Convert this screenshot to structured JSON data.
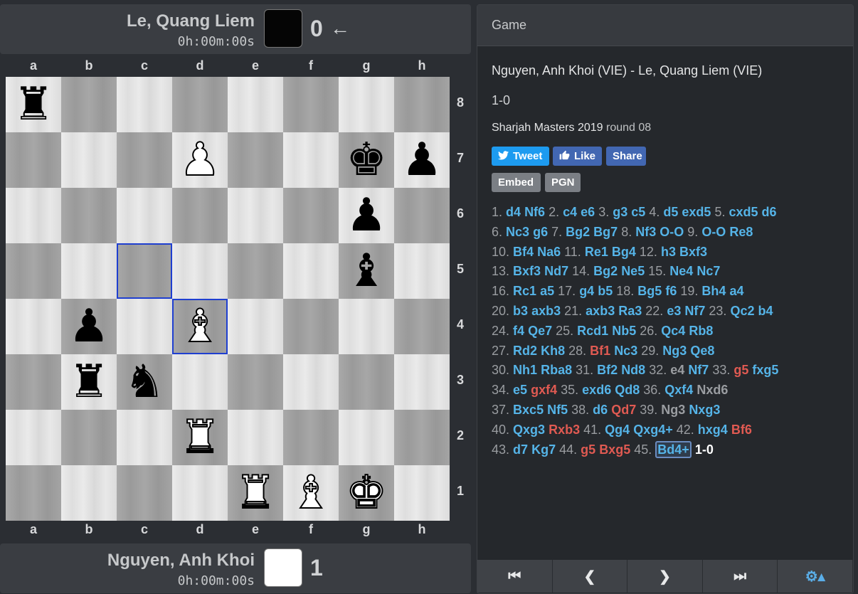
{
  "top_player": {
    "name": "Le, Quang Liem",
    "clock": "0h:00m:00s",
    "score": "0",
    "arrow": "←"
  },
  "bottom_player": {
    "name": "Nguyen, Anh Khoi",
    "clock": "0h:00m:00s",
    "score": "1"
  },
  "files": [
    "a",
    "b",
    "c",
    "d",
    "e",
    "f",
    "g",
    "h"
  ],
  "ranks": [
    "8",
    "7",
    "6",
    "5",
    "4",
    "3",
    "2",
    "1"
  ],
  "board": {
    "highlight_squares": [
      "c5",
      "d4"
    ],
    "pieces": [
      {
        "sq": "a8",
        "color": "b",
        "type": "rook",
        "glyph": "♜"
      },
      {
        "sq": "d7",
        "color": "w",
        "type": "pawn",
        "glyph": "♟"
      },
      {
        "sq": "g7",
        "color": "b",
        "type": "king",
        "glyph": "♚"
      },
      {
        "sq": "h7",
        "color": "b",
        "type": "pawn",
        "glyph": "♟"
      },
      {
        "sq": "g6",
        "color": "b",
        "type": "pawn",
        "glyph": "♟"
      },
      {
        "sq": "g5",
        "color": "b",
        "type": "bishop",
        "glyph": "♝"
      },
      {
        "sq": "b4",
        "color": "b",
        "type": "pawn",
        "glyph": "♟"
      },
      {
        "sq": "d4",
        "color": "w",
        "type": "bishop",
        "glyph": "♝"
      },
      {
        "sq": "b3",
        "color": "b",
        "type": "rook",
        "glyph": "♜"
      },
      {
        "sq": "c3",
        "color": "b",
        "type": "knight",
        "glyph": "♞"
      },
      {
        "sq": "d2",
        "color": "w",
        "type": "rook",
        "glyph": "♜"
      },
      {
        "sq": "e1",
        "color": "w",
        "type": "rook",
        "glyph": "♜"
      },
      {
        "sq": "f1",
        "color": "w",
        "type": "bishop",
        "glyph": "♝"
      },
      {
        "sq": "g1",
        "color": "w",
        "type": "king",
        "glyph": "♚"
      }
    ]
  },
  "panel": {
    "header": "Game",
    "title": "Nguyen, Anh Khoi (VIE) - Le, Quang Liem (VIE)",
    "result": "1-0",
    "event": "Sharjah Masters 2019",
    "round": "round 08",
    "buttons": {
      "tweet": "Tweet",
      "like": "Like",
      "share": "Share",
      "embed": "Embed",
      "pgn": "PGN"
    }
  },
  "colors": {
    "move": "#55b4e8",
    "move_alt": "#e05a52",
    "move_dim": "#9a9da1",
    "highlight": "#1f3fd0"
  },
  "move_lines": [
    [
      [
        "n",
        "1."
      ],
      [
        "m",
        "d4"
      ],
      [
        "m",
        "Nf6"
      ],
      [
        "n",
        "2."
      ],
      [
        "m",
        "c4"
      ],
      [
        "m",
        "e6"
      ],
      [
        "n",
        "3."
      ],
      [
        "m",
        "g3"
      ],
      [
        "m",
        "c5"
      ],
      [
        "n",
        "4."
      ],
      [
        "m",
        "d5"
      ],
      [
        "m",
        "exd5"
      ],
      [
        "n",
        "5."
      ],
      [
        "m",
        "cxd5"
      ],
      [
        "m",
        "d6"
      ]
    ],
    [
      [
        "n",
        "6."
      ],
      [
        "m",
        "Nc3"
      ],
      [
        "m",
        "g6"
      ],
      [
        "n",
        "7."
      ],
      [
        "m",
        "Bg2"
      ],
      [
        "m",
        "Bg7"
      ],
      [
        "n",
        "8."
      ],
      [
        "m",
        "Nf3"
      ],
      [
        "m",
        "O-O"
      ],
      [
        "n",
        "9."
      ],
      [
        "m",
        "O-O"
      ],
      [
        "m",
        "Re8"
      ]
    ],
    [
      [
        "n",
        "10."
      ],
      [
        "m",
        "Bf4"
      ],
      [
        "m",
        "Na6"
      ],
      [
        "n",
        "11."
      ],
      [
        "m",
        "Re1"
      ],
      [
        "m",
        "Bg4"
      ],
      [
        "n",
        "12."
      ],
      [
        "m",
        "h3"
      ],
      [
        "m",
        "Bxf3"
      ]
    ],
    [
      [
        "n",
        "13."
      ],
      [
        "m",
        "Bxf3"
      ],
      [
        "m",
        "Nd7"
      ],
      [
        "n",
        "14."
      ],
      [
        "m",
        "Bg2"
      ],
      [
        "m",
        "Ne5"
      ],
      [
        "n",
        "15."
      ],
      [
        "m",
        "Ne4"
      ],
      [
        "m",
        "Nc7"
      ]
    ],
    [
      [
        "n",
        "16."
      ],
      [
        "m",
        "Rc1"
      ],
      [
        "m",
        "a5"
      ],
      [
        "n",
        "17."
      ],
      [
        "m",
        "g4"
      ],
      [
        "m",
        "b5"
      ],
      [
        "n",
        "18."
      ],
      [
        "m",
        "Bg5"
      ],
      [
        "m",
        "f6"
      ],
      [
        "n",
        "19."
      ],
      [
        "m",
        "Bh4"
      ],
      [
        "m",
        "a4"
      ]
    ],
    [
      [
        "n",
        "20."
      ],
      [
        "m",
        "b3"
      ],
      [
        "m",
        "axb3"
      ],
      [
        "n",
        "21."
      ],
      [
        "m",
        "axb3"
      ],
      [
        "m",
        "Ra3"
      ],
      [
        "n",
        "22."
      ],
      [
        "m",
        "e3"
      ],
      [
        "m",
        "Nf7"
      ],
      [
        "n",
        "23."
      ],
      [
        "m",
        "Qc2"
      ],
      [
        "m",
        "b4"
      ]
    ],
    [
      [
        "n",
        "24."
      ],
      [
        "m",
        "f4"
      ],
      [
        "m",
        "Qe7"
      ],
      [
        "n",
        "25."
      ],
      [
        "m",
        "Rcd1"
      ],
      [
        "m",
        "Nb5"
      ],
      [
        "n",
        "26."
      ],
      [
        "m",
        "Qc4"
      ],
      [
        "m",
        "Rb8"
      ]
    ],
    [
      [
        "n",
        "27."
      ],
      [
        "m",
        "Rd2"
      ],
      [
        "m",
        "Kh8"
      ],
      [
        "n",
        "28."
      ],
      [
        "r",
        "Bf1"
      ],
      [
        "m",
        "Nc3"
      ],
      [
        "n",
        "29."
      ],
      [
        "m",
        "Ng3"
      ],
      [
        "m",
        "Qe8"
      ]
    ],
    [
      [
        "n",
        "30."
      ],
      [
        "m",
        "Nh1"
      ],
      [
        "m",
        "Rba8"
      ],
      [
        "n",
        "31."
      ],
      [
        "m",
        "Bf2"
      ],
      [
        "m",
        "Nd8"
      ],
      [
        "n",
        "32."
      ],
      [
        "g",
        "e4"
      ],
      [
        "m",
        "Nf7"
      ],
      [
        "n",
        "33."
      ],
      [
        "r",
        "g5"
      ],
      [
        "m",
        "fxg5"
      ]
    ],
    [
      [
        "n",
        "34."
      ],
      [
        "m",
        "e5"
      ],
      [
        "r",
        "gxf4"
      ],
      [
        "n",
        "35."
      ],
      [
        "m",
        "exd6"
      ],
      [
        "m",
        "Qd8"
      ],
      [
        "n",
        "36."
      ],
      [
        "m",
        "Qxf4"
      ],
      [
        "g",
        "Nxd6"
      ]
    ],
    [
      [
        "n",
        "37."
      ],
      [
        "m",
        "Bxc5"
      ],
      [
        "m",
        "Nf5"
      ],
      [
        "n",
        "38."
      ],
      [
        "m",
        "d6"
      ],
      [
        "r",
        "Qd7"
      ],
      [
        "n",
        "39."
      ],
      [
        "g",
        "Ng3"
      ],
      [
        "m",
        "Nxg3"
      ]
    ],
    [
      [
        "n",
        "40."
      ],
      [
        "m",
        "Qxg3"
      ],
      [
        "r",
        "Rxb3"
      ],
      [
        "n",
        "41."
      ],
      [
        "m",
        "Qg4"
      ],
      [
        "m",
        "Qxg4+"
      ],
      [
        "n",
        "42."
      ],
      [
        "m",
        "hxg4"
      ],
      [
        "r",
        "Bf6"
      ]
    ],
    [
      [
        "n",
        "43."
      ],
      [
        "m",
        "d7"
      ],
      [
        "m",
        "Kg7"
      ],
      [
        "n",
        "44."
      ],
      [
        "r",
        "g5"
      ],
      [
        "r",
        "Bxg5"
      ],
      [
        "n",
        "45."
      ],
      [
        "c",
        "Bd4+"
      ],
      [
        "x",
        "1-0"
      ]
    ]
  ],
  "nav": [
    {
      "name": "first-move-button",
      "glyph": "⏮"
    },
    {
      "name": "previous-move-button",
      "glyph": "❮"
    },
    {
      "name": "next-move-button",
      "glyph": "❯"
    },
    {
      "name": "last-move-button",
      "glyph": "⏭"
    },
    {
      "name": "settings-button",
      "glyph": "⚙▴"
    }
  ]
}
